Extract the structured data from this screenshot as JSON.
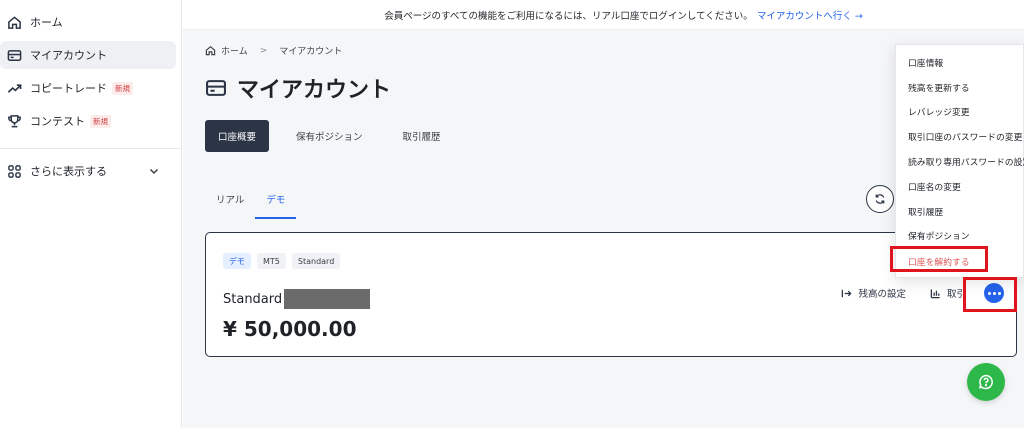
{
  "sidebar": {
    "items": [
      {
        "label": "ホーム",
        "icon": "home-icon"
      },
      {
        "label": "マイアカウント",
        "icon": "wallet-icon"
      },
      {
        "label": "コピートレード",
        "icon": "trend-up-icon",
        "badge": "新規"
      },
      {
        "label": "コンテスト",
        "icon": "trophy-icon",
        "badge": "新規"
      }
    ],
    "more_label": "さらに表示する"
  },
  "banner": {
    "text": "会員ページのすべての機能をご利用になるには、リアル口座でログインしてください。",
    "link": "マイアカウントへ行く →"
  },
  "breadcrumb": {
    "home": "ホーム",
    "separator": ">",
    "current": "マイアカウント"
  },
  "page_title": "マイアカウント",
  "tabs": [
    {
      "label": "口座概要",
      "active": true
    },
    {
      "label": "保有ポジション",
      "active": false
    },
    {
      "label": "取引履歴",
      "active": false
    }
  ],
  "subtabs": [
    {
      "label": "リアル",
      "active": false
    },
    {
      "label": "デモ",
      "active": true
    }
  ],
  "account": {
    "chips": [
      "デモ",
      "MT5",
      "Standard"
    ],
    "name": "Standard",
    "balance": "¥ 50,000.00",
    "actions": {
      "balance_setting": "残高の設定",
      "trade": "取引"
    }
  },
  "menu": {
    "items": [
      "口座情報",
      "残高を更新する",
      "レバレッジ変更",
      "取引口座のパスワードの変更",
      "読み取り専用パスワードの設定",
      "口座名の変更",
      "取引履歴",
      "保有ポジション",
      "口座を解約する"
    ]
  },
  "colors": {
    "accent": "#2563eb",
    "dark": "#2b3545",
    "danger": "#e05656",
    "highlight": "#e0141c",
    "help": "#2eb84a"
  }
}
